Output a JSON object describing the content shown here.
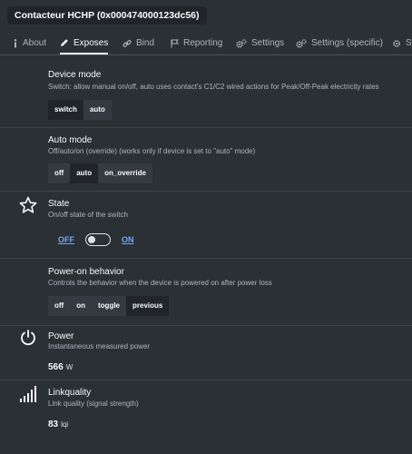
{
  "window": {
    "title": "Contacteur HCHP (0x000474000123dc56)"
  },
  "tabs": [
    {
      "label": "About",
      "icon": "info-icon",
      "active": false
    },
    {
      "label": "Exposes",
      "icon": "pencil-icon",
      "active": true
    },
    {
      "label": "Bind",
      "icon": "link-icon",
      "active": false
    },
    {
      "label": "Reporting",
      "icon": "flag-icon",
      "active": false
    },
    {
      "label": "Settings",
      "icon": "gears-icon",
      "active": false
    },
    {
      "label": "Settings (specific)",
      "icon": "gears-icon",
      "active": false
    },
    {
      "label": "St",
      "icon": "gears-icon",
      "active": false
    }
  ],
  "device_mode": {
    "label": "Device mode",
    "description": "Switch: allow manual on/off, auto uses contact's C1/C2 wired actions for Peak/Off-Peak electricity rates",
    "options": [
      "switch",
      "auto"
    ],
    "selected": "switch"
  },
  "auto_mode": {
    "label": "Auto mode",
    "description": "Off/auto/on (override) (works only if device is set to \"auto\" mode)",
    "options": [
      "off",
      "auto",
      "on_override"
    ],
    "selected": "auto"
  },
  "state": {
    "label": "State",
    "description": "On/off state of the switch",
    "off_label": "OFF",
    "on_label": "ON",
    "value": "OFF",
    "icon": "star-icon"
  },
  "power_on_behavior": {
    "label": "Power-on behavior",
    "description": "Controls the behavior when the device is powered on after power loss",
    "options": [
      "off",
      "on",
      "toggle",
      "previous"
    ],
    "selected": "previous"
  },
  "power": {
    "label": "Power",
    "description": "Instantaneous measured power",
    "value": "566",
    "unit": "W",
    "icon": "power-icon"
  },
  "linkquality": {
    "label": "Linkquality",
    "description": "Link quality (signal strength)",
    "value": "83",
    "unit": "lqi",
    "icon": "signal-icon"
  }
}
